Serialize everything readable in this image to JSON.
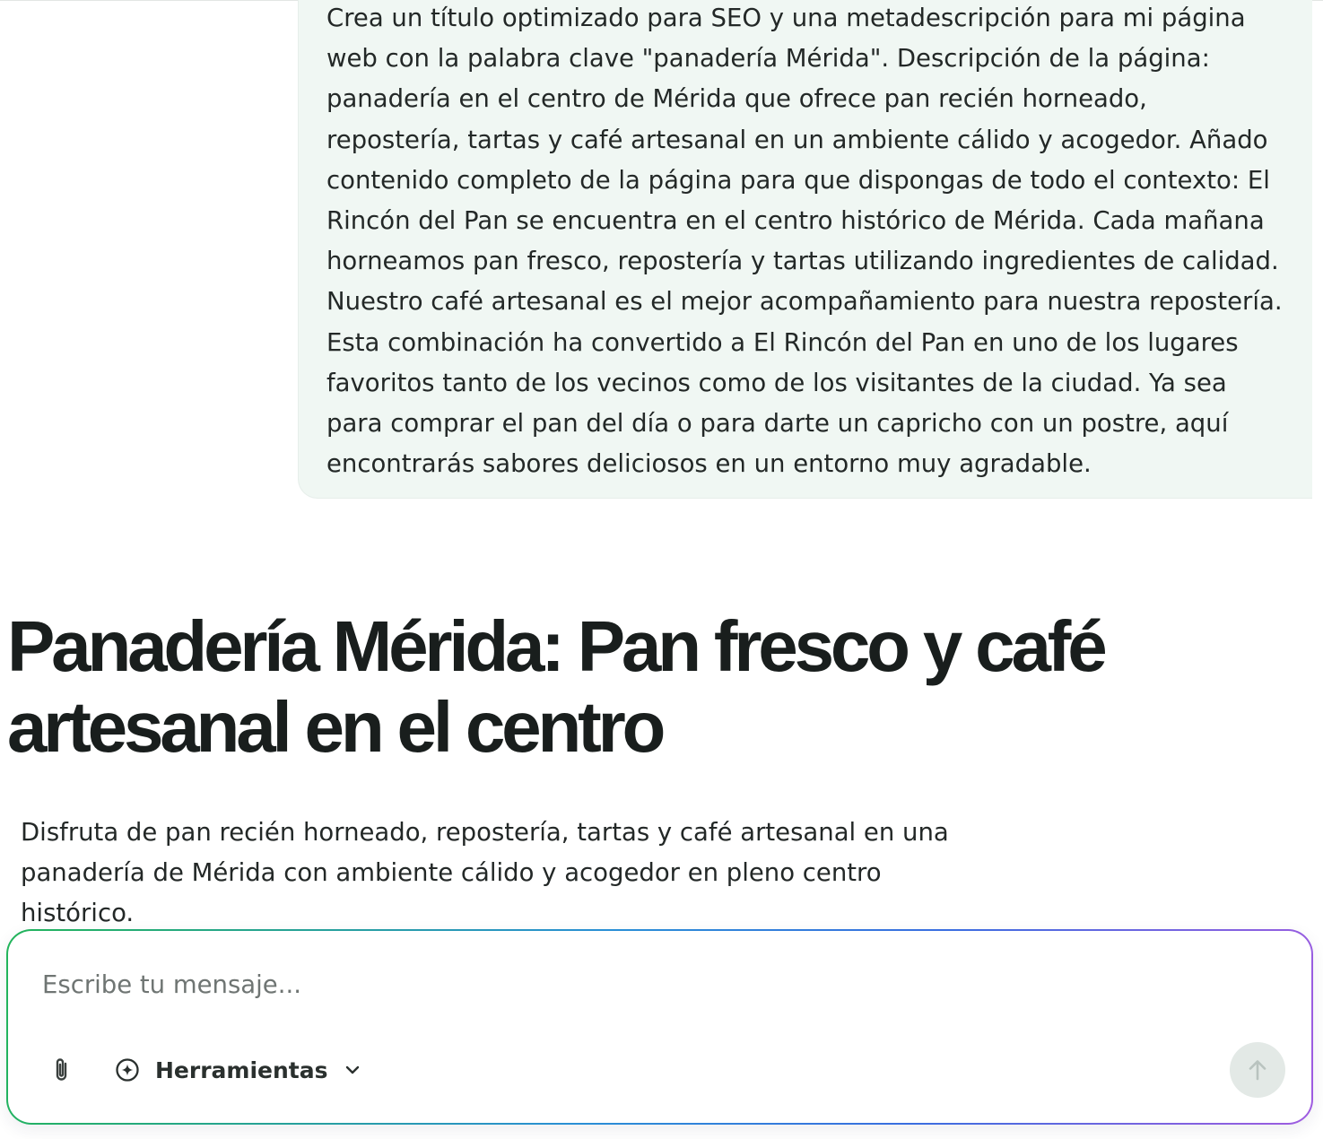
{
  "conversation": {
    "user_message": "Crea un título optimizado para SEO y una metadescripción para mi página web con la palabra clave \"panadería Mérida\". Descripción de la página: panadería en el centro de Mérida que ofrece pan recién horneado, repostería, tartas y café artesanal en un ambiente cálido y acogedor. Añado contenido completo de la página para que dispongas de todo el contexto: El Rincón del Pan se encuentra en el centro histórico de Mérida. Cada mañana horneamos pan fresco, repostería y tartas utilizando ingredientes de calidad. Nuestro café artesanal es el mejor acompañamiento para nuestra repostería. Esta combinación ha convertido a El Rincón del Pan en uno de los lugares favoritos tanto de los vecinos como de los visitantes de la ciudad. Ya sea para comprar el pan del día o para darte un capricho con un postre, aquí encontrarás sabores deliciosos en un entorno muy agradable.",
    "response_title": "Panadería Mérida: Pan fresco y café artesanal en el centro",
    "response_description": "Disfruta de pan recién horneado, repostería, tartas y café artesanal en una panadería de Mérida con ambiente cálido y acogedor en pleno centro histórico."
  },
  "composer": {
    "placeholder": "Escribe tu mensaje...",
    "value": "",
    "tools_label": "Herramientas",
    "icons": {
      "attach": "paperclip-icon",
      "tools": "sparkle-icon",
      "dropdown": "chevron-down-icon",
      "send": "arrow-up-icon"
    }
  },
  "colors": {
    "user_bubble_bg": "#f0f7f3",
    "send_button_bg": "#e3e9e6",
    "composer_gradient_start": "#22b45a",
    "composer_gradient_end": "#a05ce0"
  }
}
